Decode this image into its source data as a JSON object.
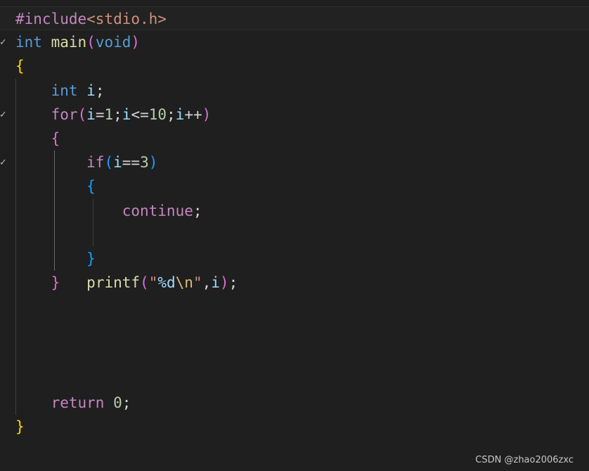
{
  "lines": [
    [
      {
        "t": "#include",
        "c": "#c586c0"
      },
      {
        "t": "<stdio.h>",
        "c": "#ce9178"
      }
    ],
    [
      {
        "t": "int",
        "c": "#569cd6"
      },
      {
        "t": " ",
        "c": "#d4d4d4"
      },
      {
        "t": "main",
        "c": "#dcdcaa"
      },
      {
        "t": "(",
        "c": "#da70d6"
      },
      {
        "t": "void",
        "c": "#569cd6"
      },
      {
        "t": ")",
        "c": "#da70d6"
      }
    ],
    [
      {
        "t": "{",
        "c": "#ffd700"
      }
    ],
    [
      {
        "t": "    ",
        "c": "#d4d4d4"
      },
      {
        "t": "int",
        "c": "#569cd6"
      },
      {
        "t": " ",
        "c": "#d4d4d4"
      },
      {
        "t": "i",
        "c": "#9cdcfe"
      },
      {
        "t": ";",
        "c": "#d4d4d4"
      }
    ],
    [
      {
        "t": "    ",
        "c": "#d4d4d4"
      },
      {
        "t": "for",
        "c": "#c586c0"
      },
      {
        "t": "(",
        "c": "#da70d6"
      },
      {
        "t": "i",
        "c": "#9cdcfe"
      },
      {
        "t": "=",
        "c": "#d4d4d4"
      },
      {
        "t": "1",
        "c": "#b5cea8"
      },
      {
        "t": ";",
        "c": "#d4d4d4"
      },
      {
        "t": "i",
        "c": "#9cdcfe"
      },
      {
        "t": "<=",
        "c": "#d4d4d4"
      },
      {
        "t": "10",
        "c": "#b5cea8"
      },
      {
        "t": ";",
        "c": "#d4d4d4"
      },
      {
        "t": "i",
        "c": "#9cdcfe"
      },
      {
        "t": "++",
        "c": "#d4d4d4"
      },
      {
        "t": ")",
        "c": "#da70d6"
      }
    ],
    [
      {
        "t": "    ",
        "c": "#d4d4d4"
      },
      {
        "t": "{",
        "c": "#da70d6"
      }
    ],
    [
      {
        "t": "        ",
        "c": "#d4d4d4"
      },
      {
        "t": "if",
        "c": "#c586c0"
      },
      {
        "t": "(",
        "c": "#179fff"
      },
      {
        "t": "i",
        "c": "#9cdcfe"
      },
      {
        "t": "==",
        "c": "#d4d4d4"
      },
      {
        "t": "3",
        "c": "#b5cea8"
      },
      {
        "t": ")",
        "c": "#179fff"
      }
    ],
    [
      {
        "t": "        ",
        "c": "#d4d4d4"
      },
      {
        "t": "{",
        "c": "#179fff"
      }
    ],
    [
      {
        "t": "            ",
        "c": "#d4d4d4"
      },
      {
        "t": "continue",
        "c": "#c586c0"
      },
      {
        "t": ";",
        "c": "#d4d4d4"
      }
    ],
    [],
    [
      {
        "t": "        ",
        "c": "#d4d4d4"
      },
      {
        "t": "}",
        "c": "#179fff"
      }
    ],
    [
      {
        "t": "    ",
        "c": "#d4d4d4"
      },
      {
        "t": "}",
        "c": "#da70d6"
      },
      {
        "t": "   ",
        "c": "#d4d4d4"
      },
      {
        "t": "printf",
        "c": "#dcdcaa"
      },
      {
        "t": "(",
        "c": "#da70d6"
      },
      {
        "t": "\"",
        "c": "#ce9178"
      },
      {
        "t": "%d",
        "c": "#9cdcfe"
      },
      {
        "t": "\\n",
        "c": "#d7ba7d"
      },
      {
        "t": "\"",
        "c": "#ce9178"
      },
      {
        "t": ",",
        "c": "#d4d4d4"
      },
      {
        "t": "i",
        "c": "#9cdcfe"
      },
      {
        "t": ")",
        "c": "#da70d6"
      },
      {
        "t": ";",
        "c": "#d4d4d4"
      }
    ],
    [],
    [],
    [],
    [],
    [
      {
        "t": "    ",
        "c": "#d4d4d4"
      },
      {
        "t": "return",
        "c": "#c586c0"
      },
      {
        "t": " ",
        "c": "#d4d4d4"
      },
      {
        "t": "0",
        "c": "#b5cea8"
      },
      {
        "t": ";",
        "c": "#d4d4d4"
      }
    ],
    [
      {
        "t": "}",
        "c": "#ffd700"
      }
    ]
  ],
  "fold_markers": [
    {
      "line": 1,
      "glyph": "✓"
    },
    {
      "line": 4,
      "glyph": "✓"
    },
    {
      "line": 6,
      "glyph": "✓"
    }
  ],
  "current_line": 0,
  "watermark": "CSDN @zhao2006zxc"
}
